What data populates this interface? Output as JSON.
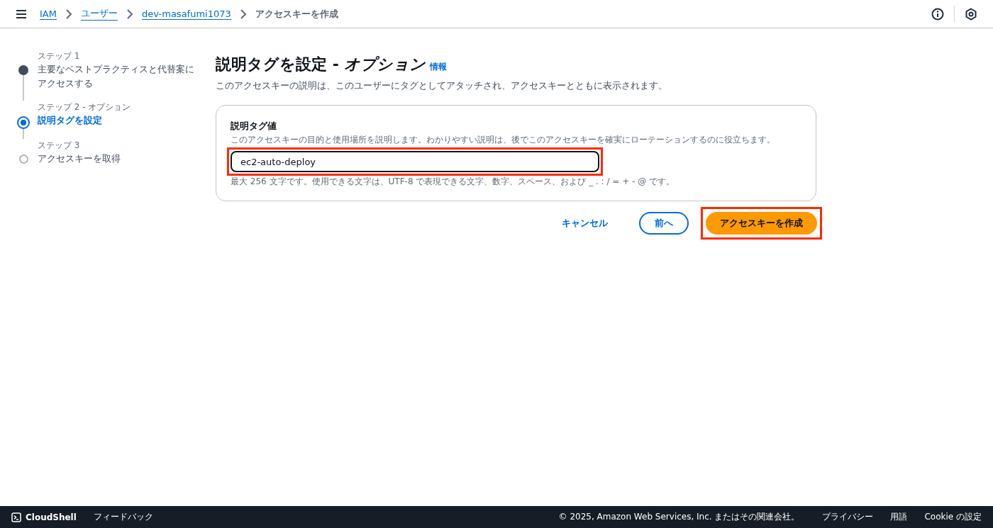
{
  "breadcrumbs": [
    {
      "label": "IAM",
      "link": true
    },
    {
      "label": "ユーザー",
      "link": true
    },
    {
      "label": "dev-masafumi1073",
      "link": true
    },
    {
      "label": "アクセスキーを作成",
      "link": false
    }
  ],
  "steps": [
    {
      "step": "ステップ 1",
      "title": "主要なベストプラクティスと代替案にアクセスする",
      "kind": "done"
    },
    {
      "step": "ステップ 2 - オプション",
      "title": "説明タグを設定",
      "kind": "current"
    },
    {
      "step": "ステップ 3",
      "title": "アクセスキーを取得",
      "kind": "todo"
    }
  ],
  "page": {
    "title": "説明タグを設定 - ",
    "title_italic": "オプション",
    "info_link": "情報",
    "description": "このアクセスキーの説明は、このユーザーにタグとしてアタッチされ、アクセスキーとともに表示されます。"
  },
  "field": {
    "label": "説明タグ値",
    "help": "このアクセスキーの目的と使用場所を説明します。わかりやすい説明は、後でこのアクセスキーを確実にローテーションするのに役立ちます。",
    "value": "ec2-auto-deploy",
    "constraint": "最大 256 文字です。使用できる文字は、UTF-8 で表現できる文字、数字、スペース、および _ . : / = + - @ です。",
    "highlighted": true
  },
  "buttons": [
    {
      "label": "キャンセル",
      "kind": "link",
      "highlighted": false
    },
    {
      "label": "前へ",
      "kind": "normal",
      "highlighted": false
    },
    {
      "label": "アクセスキーを作成",
      "kind": "primary",
      "highlighted": true
    }
  ],
  "footer": {
    "cloudshell": "CloudShell",
    "feedback": "フィードバック",
    "copyright": "© 2025, Amazon Web Services, Inc. またはその関連会社。",
    "links": [
      "プライバシー",
      "用語",
      "Cookie の設定"
    ]
  }
}
